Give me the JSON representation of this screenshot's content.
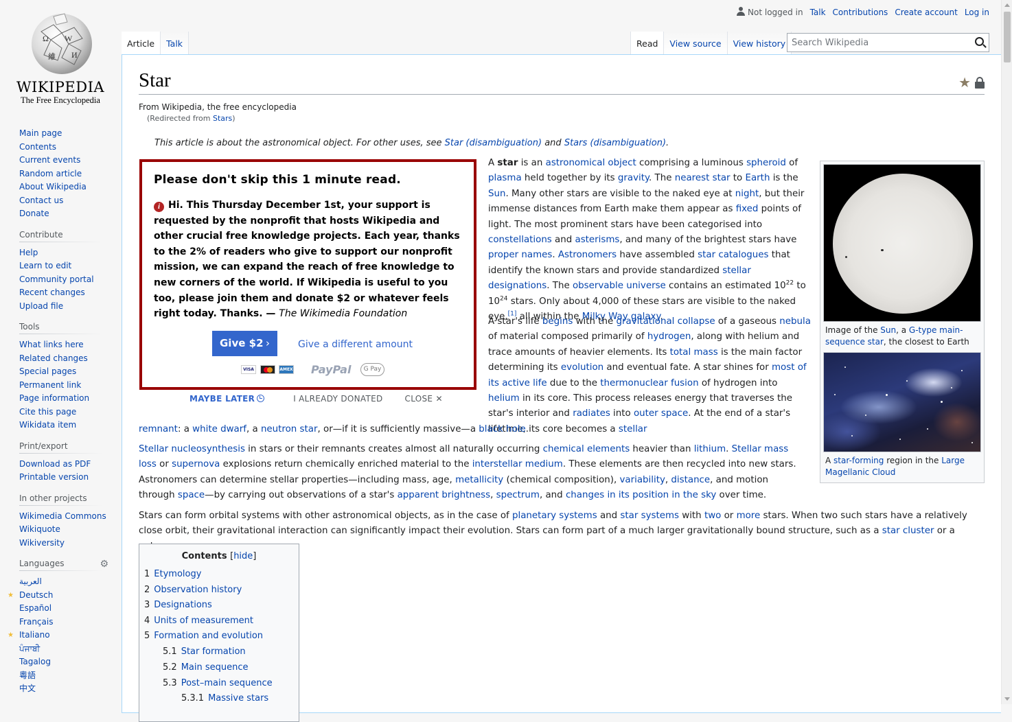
{
  "logo": {
    "wordmark": "Wikipedia",
    "tagline": "The Free Encyclopedia"
  },
  "personal": {
    "not_logged_in": "Not logged in",
    "talk": "Talk",
    "contributions": "Contributions",
    "create_account": "Create account",
    "log_in": "Log in"
  },
  "tabs": {
    "article": "Article",
    "talk": "Talk",
    "read": "Read",
    "view_source": "View source",
    "view_history": "View history"
  },
  "search": {
    "placeholder": "Search Wikipedia"
  },
  "sidebar": {
    "navigation": [
      "Main page",
      "Contents",
      "Current events",
      "Random article",
      "About Wikipedia",
      "Contact us",
      "Donate"
    ],
    "contribute": {
      "heading": "Contribute",
      "items": [
        "Help",
        "Learn to edit",
        "Community portal",
        "Recent changes",
        "Upload file"
      ]
    },
    "tools": {
      "heading": "Tools",
      "items": [
        "What links here",
        "Related changes",
        "Special pages",
        "Permanent link",
        "Page information",
        "Cite this page",
        "Wikidata item"
      ]
    },
    "print": {
      "heading": "Print/export",
      "items": [
        "Download as PDF",
        "Printable version"
      ]
    },
    "projects": {
      "heading": "In other projects",
      "items": [
        "Wikimedia Commons",
        "Wikiquote",
        "Wikiversity"
      ]
    },
    "languages": {
      "heading": "Languages",
      "items": [
        "العربية",
        "Deutsch",
        "Español",
        "Français",
        "Italiano",
        "ਪੰਜਾਬੀ",
        "Tagalog",
        "粵語",
        "中文"
      ]
    }
  },
  "article": {
    "title": "Star",
    "from": "From Wikipedia, the free encyclopedia",
    "redirect_prefix": "(Redirected from ",
    "redirect_link": "Stars",
    "redirect_suffix": ")",
    "hatnote": {
      "pre": "This article is about the astronomical object. For other uses, see ",
      "link1": "Star (disambiguation)",
      "mid": " and ",
      "link2": "Stars (disambiguation)",
      "post": "."
    }
  },
  "banner": {
    "heading": "Please don't skip this 1 minute read.",
    "message": "Hi. This Thursday December 1st, your support is requested by the nonprofit that hosts Wikipedia and other crucial free knowledge projects. Each year, thanks to the 2% of readers who give to support our nonprofit mission, we can expand the reach of free knowledge to new corners of the world. If Wikipedia is useful to you too, please join them and donate $2 or whatever feels right today. Thanks. — ",
    "foundation": "The Wikimedia Foundation",
    "give_label": "Give $2",
    "other_amount": "Give a different amount",
    "pay_visa": "VISA",
    "pay_amex": "AMEX",
    "pay_paypal": "PayPal",
    "pay_gpay": "G Pay",
    "maybe_later": "MAYBE LATER",
    "already_donated": "I ALREADY DONATED",
    "close": "CLOSE"
  },
  "thumbs": {
    "cap1": [
      "Image of the ",
      "Sun",
      ", a ",
      "G-type main-sequence star",
      ", the closest to Earth"
    ],
    "cap2": [
      "A ",
      "star-forming",
      " region in the ",
      "Large Magellanic Cloud"
    ]
  },
  "toc": {
    "title": "Contents",
    "hide": "hide",
    "items": [
      {
        "num": "1",
        "label": "Etymology",
        "level": 1
      },
      {
        "num": "2",
        "label": "Observation history",
        "level": 1
      },
      {
        "num": "3",
        "label": "Designations",
        "level": 1
      },
      {
        "num": "4",
        "label": "Units of measurement",
        "level": 1
      },
      {
        "num": "5",
        "label": "Formation and evolution",
        "level": 1
      },
      {
        "num": "5.1",
        "label": "Star formation",
        "level": 2
      },
      {
        "num": "5.2",
        "label": "Main sequence",
        "level": 2
      },
      {
        "num": "5.3",
        "label": "Post–main sequence",
        "level": 2
      },
      {
        "num": "5.3.1",
        "label": "Massive stars",
        "level": 3
      }
    ]
  },
  "paragraphs": {
    "p1": [
      [
        "t",
        "A "
      ],
      [
        "b",
        "star"
      ],
      [
        "t",
        " is an "
      ],
      [
        "a",
        "astronomical object"
      ],
      [
        "t",
        " comprising a luminous "
      ],
      [
        "a",
        "spheroid"
      ],
      [
        "t",
        " of "
      ],
      [
        "a",
        "plasma"
      ],
      [
        "t",
        " held together by its "
      ],
      [
        "a",
        "gravity"
      ],
      [
        "t",
        ". The "
      ],
      [
        "a",
        "nearest star"
      ],
      [
        "t",
        " to "
      ],
      [
        "a",
        "Earth"
      ],
      [
        "t",
        " is the "
      ],
      [
        "a",
        "Sun"
      ],
      [
        "t",
        ". Many other stars are visible to the naked eye at "
      ],
      [
        "a",
        "night"
      ],
      [
        "t",
        ", but their immense distances from Earth make them appear as "
      ],
      [
        "a",
        "fixed"
      ],
      [
        "t",
        " points of light. The most prominent stars have been categorised into "
      ],
      [
        "a",
        "constellations"
      ],
      [
        "t",
        " and "
      ],
      [
        "a",
        "asterisms"
      ],
      [
        "t",
        ", and many of the brightest stars have "
      ],
      [
        "a",
        "proper names"
      ],
      [
        "t",
        ". "
      ],
      [
        "a",
        "Astronomers"
      ],
      [
        "t",
        " have assembled "
      ],
      [
        "a",
        "star catalogues"
      ],
      [
        "t",
        " that identify the known stars and provide standardized "
      ],
      [
        "a",
        "stellar designations"
      ],
      [
        "t",
        ". The "
      ],
      [
        "a",
        "observable universe"
      ],
      [
        "t",
        " contains an estimated 10"
      ],
      [
        "sup",
        "22"
      ],
      [
        "t",
        " to 10"
      ],
      [
        "sup",
        "24"
      ],
      [
        "t",
        " stars. Only about 4,000 of these stars are visible to the naked eye,"
      ],
      [
        "supa",
        "[1]"
      ],
      [
        "t",
        " all within the "
      ],
      [
        "a",
        "Milky Way galaxy"
      ],
      [
        "t",
        "."
      ]
    ],
    "p2": [
      [
        "t",
        "A star's life "
      ],
      [
        "a",
        "begins"
      ],
      [
        "t",
        " with the "
      ],
      [
        "a",
        "gravitational collapse"
      ],
      [
        "t",
        " of a gaseous "
      ],
      [
        "a",
        "nebula"
      ],
      [
        "t",
        " of material composed primarily of "
      ],
      [
        "a",
        "hydrogen"
      ],
      [
        "t",
        ", along with helium and trace amounts of heavier elements. Its "
      ],
      [
        "a",
        "total mass"
      ],
      [
        "t",
        " is the main factor determining its "
      ],
      [
        "a",
        "evolution"
      ],
      [
        "t",
        " and eventual fate. A star shines for "
      ],
      [
        "a",
        "most of its active life"
      ],
      [
        "t",
        " due to the "
      ],
      [
        "a",
        "thermonuclear fusion"
      ],
      [
        "t",
        " of hydrogen into "
      ],
      [
        "a",
        "helium"
      ],
      [
        "t",
        " in its core. This process releases energy that traverses the star's interior and "
      ],
      [
        "a",
        "radiates"
      ],
      [
        "t",
        " into "
      ],
      [
        "a",
        "outer space"
      ],
      [
        "t",
        ". At the end of a star's lifetime, its core becomes a "
      ],
      [
        "a",
        "stellar"
      ]
    ],
    "p2tail": [
      [
        "a",
        "remnant"
      ],
      [
        "t",
        ": a "
      ],
      [
        "a",
        "white dwarf"
      ],
      [
        "t",
        ", a "
      ],
      [
        "a",
        "neutron star"
      ],
      [
        "t",
        ", or—if it is sufficiently massive—a "
      ],
      [
        "a",
        "black hole"
      ],
      [
        "t",
        "."
      ]
    ],
    "p3": [
      [
        "a",
        "Stellar nucleosynthesis"
      ],
      [
        "t",
        " in stars or their remnants creates almost all naturally occurring "
      ],
      [
        "a",
        "chemical elements"
      ],
      [
        "t",
        " heavier than "
      ],
      [
        "a",
        "lithium"
      ],
      [
        "t",
        ". "
      ],
      [
        "a",
        "Stellar mass loss"
      ],
      [
        "t",
        " or "
      ],
      [
        "a",
        "supernova"
      ],
      [
        "t",
        " explosions return chemically enriched material to the "
      ],
      [
        "a",
        "interstellar medium"
      ],
      [
        "t",
        ". These elements are then recycled into new stars. Astronomers can determine stellar properties—including mass, age, "
      ],
      [
        "a",
        "metallicity"
      ],
      [
        "t",
        " (chemical composition), "
      ],
      [
        "a",
        "variability"
      ],
      [
        "t",
        ", "
      ],
      [
        "a",
        "distance"
      ],
      [
        "t",
        ", and motion through "
      ],
      [
        "a",
        "space"
      ],
      [
        "t",
        "—by carrying out observations of a star's "
      ],
      [
        "a",
        "apparent brightness"
      ],
      [
        "t",
        ", "
      ],
      [
        "a",
        "spectrum"
      ],
      [
        "t",
        ", and "
      ],
      [
        "a",
        "changes in its position in the sky"
      ],
      [
        "t",
        " over time."
      ]
    ],
    "p4": [
      [
        "t",
        "Stars can form orbital systems with other astronomical objects, as in the case of "
      ],
      [
        "a",
        "planetary systems"
      ],
      [
        "t",
        " and "
      ],
      [
        "a",
        "star systems"
      ],
      [
        "t",
        " with "
      ],
      [
        "a",
        "two"
      ],
      [
        "t",
        " or "
      ],
      [
        "a",
        "more"
      ],
      [
        "t",
        " stars. When two such stars have a relatively close orbit, their gravitational interaction can significantly impact their evolution. Stars can form part of a much larger gravitationally bound structure, such as a "
      ],
      [
        "a",
        "star cluster"
      ],
      [
        "t",
        " or a galaxy."
      ]
    ]
  },
  "colors": {
    "link": "#0645ad",
    "banner_border": "#990000",
    "button": "#3366cc"
  }
}
